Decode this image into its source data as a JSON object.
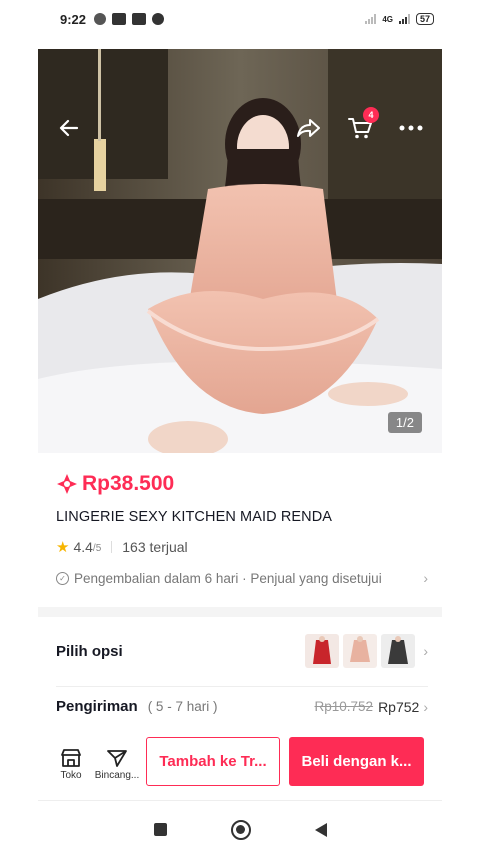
{
  "status_bar": {
    "time": "9:22",
    "network": "4G",
    "battery": "57"
  },
  "hero": {
    "page_counter": "1/2",
    "cart_count": "4",
    "back_icon": "arrow-left-icon",
    "share_icon": "share-arrow-icon",
    "cart_icon": "cart-icon",
    "more_icon": "more-dots-icon"
  },
  "product": {
    "price": "Rp38.500",
    "title": "LINGERIE SEXY KITCHEN MAID RENDA",
    "rating": "4.4",
    "rating_max": "/5",
    "sold": "163 terjual",
    "policy": "Pengembalian dalam 6 hari · Penjual yang disetujui"
  },
  "options": {
    "label": "Pilih opsi",
    "thumb_colors": [
      "#c8252b",
      "#e8b2a0",
      "#3a3a3a"
    ]
  },
  "shipping": {
    "label": "Pengiriman",
    "days": "( 5 - 7 hari )",
    "old_price": "Rp10.752",
    "new_price": "Rp752"
  },
  "actions": {
    "shop_label": "Toko",
    "chat_label": "Bincang...",
    "add_to_cart": "Tambah ke Tr...",
    "buy": "Beli dengan k..."
  },
  "colors": {
    "accent": "#fe2c55",
    "star": "#f7b500"
  }
}
